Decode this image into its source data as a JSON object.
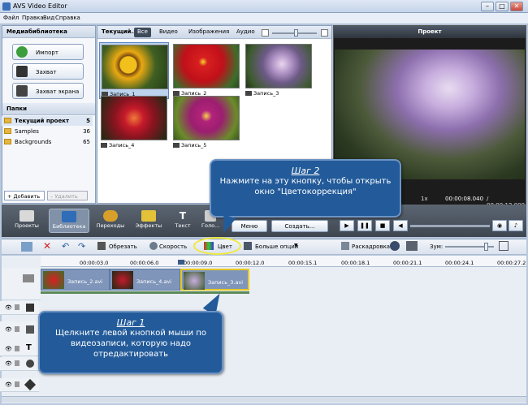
{
  "app": {
    "title": "AVS Video Editor"
  },
  "menu": [
    "Файл",
    "Правка",
    "Вид",
    "Справка"
  ],
  "media_library": {
    "title": "Медиабиблиотека",
    "buttons": {
      "import": "Импорт",
      "capture": "Захват",
      "screen_capture": "Захват экрана"
    },
    "folders_title": "Папки",
    "folders": [
      {
        "name": "Текущий проект",
        "count": "5"
      },
      {
        "name": "Samples",
        "count": "36"
      },
      {
        "name": "Backgrounds",
        "count": "65"
      }
    ],
    "add_label": "Добавить",
    "remove_label": "Удалить"
  },
  "browser": {
    "current_label": "Текущий...",
    "tabs": [
      "Все",
      "Видео",
      "Изображения",
      "Аудио"
    ],
    "thumbs": [
      "Запись_1",
      "Запись_2",
      "Запись_3",
      "Запись_4",
      "Запись_5"
    ]
  },
  "preview": {
    "title": "Проект",
    "speed": "1x",
    "time_current": "00:00:08.040",
    "time_total": "/ 00:00:12.000"
  },
  "toolbar": {
    "projects": "Проекты",
    "library": "Библиотека",
    "transitions": "Переходы",
    "effects": "Эффекты",
    "text": "Текст",
    "voice": "Голо...",
    "menu": "Меню",
    "create": "Создать..."
  },
  "timeline_toolbar": {
    "cut": "Обрезать",
    "speed": "Скорость",
    "color": "Цвет",
    "more": "Больше опций",
    "storyboard": "Раскадровка",
    "zoom": "Зум:"
  },
  "ruler": [
    "00:00:03.0",
    "00:00:06.0",
    "00:00:09.0",
    "00:00:12.0",
    "00:00:15.1",
    "00:00:18.1",
    "00:00:21.1",
    "00:00:24.1",
    "00:00:27.2"
  ],
  "clips": [
    "Запись_2.avi",
    "Запись_4.avi",
    "Запись_3.avi"
  ],
  "callouts": {
    "step1_title": "Шаг 1",
    "step1_text": "Щелкните левой кнопкой мыши по видеозаписи, которую надо отредактировать",
    "step2_title": "Шаг 2",
    "step2_text": "Нажмите на эту кнопку, чтобы открыть окно \"Цветокоррекция\""
  }
}
